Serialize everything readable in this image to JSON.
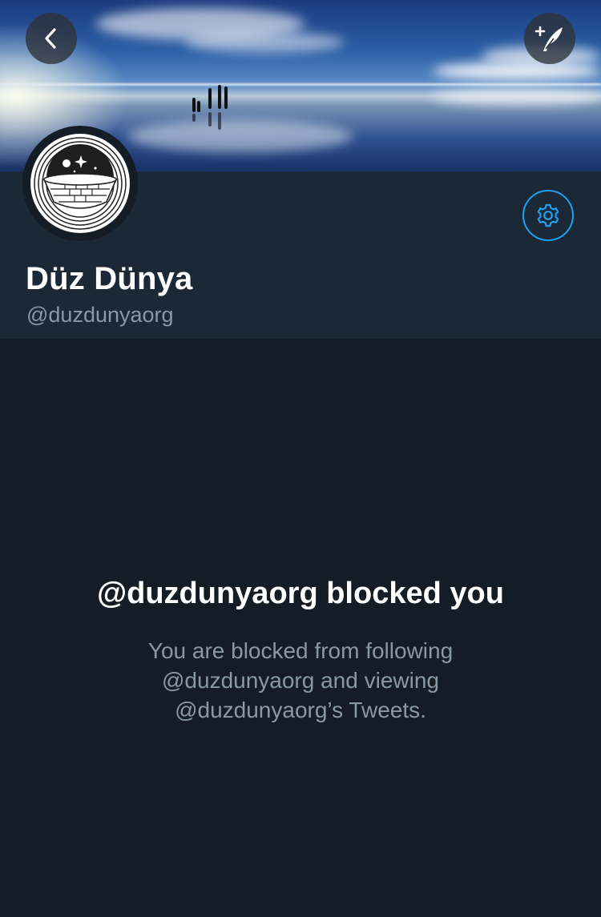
{
  "header": {
    "back_icon": "chevron-left-icon",
    "compose_icon": "compose-tweet-icon",
    "settings_icon": "gear-icon"
  },
  "profile": {
    "display_name": "Düz Dünya",
    "handle": "@duzdunyaorg"
  },
  "blocked": {
    "title": "@duzdunyaorg blocked you",
    "message": "You are blocked from following @duzdunyaorg and viewing @duzdunyaorg’s Tweets."
  },
  "colors": {
    "background": "#141d26",
    "header_band": "#1b2836",
    "accent": "#1da1f2",
    "secondary_text": "#8899a6"
  }
}
